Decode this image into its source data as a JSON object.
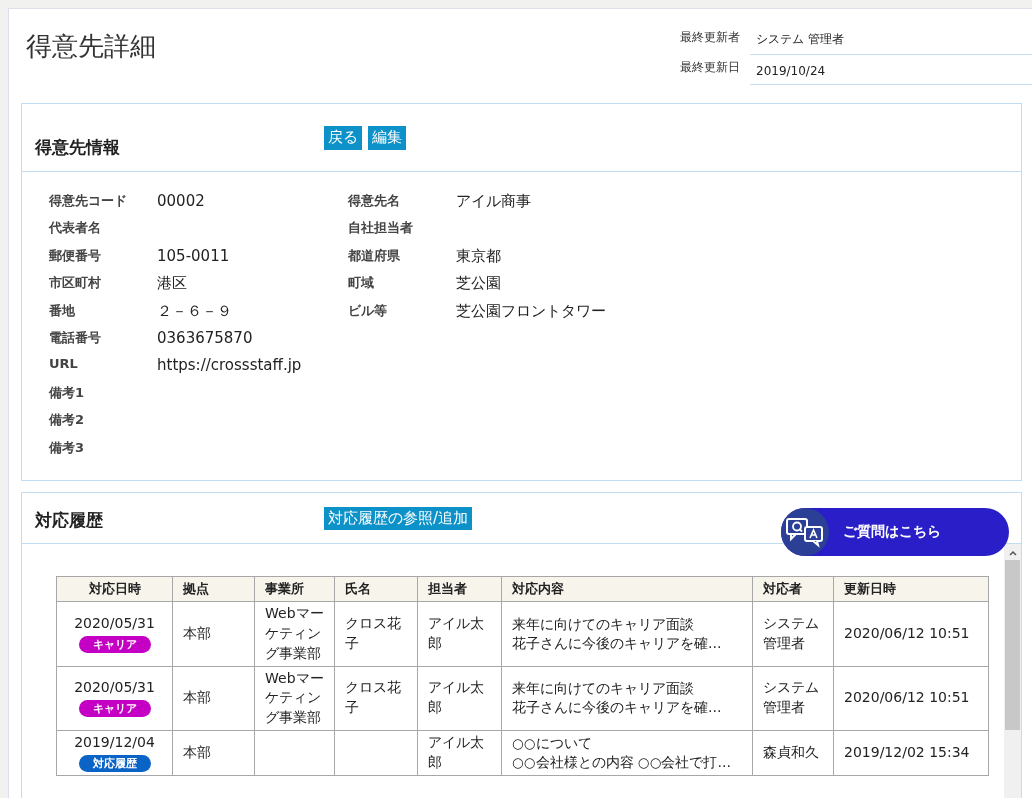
{
  "page_title": "得意先詳細",
  "meta": [
    {
      "label": "最終更新者",
      "value": "システム 管理者"
    },
    {
      "label": "最終更新日",
      "value": "2019/10/24"
    }
  ],
  "customer_info": {
    "title": "得意先情報",
    "buttons": [
      "戻る",
      "編集"
    ],
    "left_fields": [
      {
        "label": "得意先コード",
        "value": "00002"
      },
      {
        "label": "代表者名"
      },
      {
        "label": "郵便番号",
        "value": "105-0011"
      },
      {
        "label": "市区町村",
        "value": "港区"
      },
      {
        "label": "番地",
        "value": "２－６－９"
      },
      {
        "label": "電話番号",
        "value": "0363675870"
      },
      {
        "label": "URL",
        "value": "https://crossstaff.jp"
      },
      {
        "label": "備考1"
      },
      {
        "label": "備考2"
      },
      {
        "label": "備考3"
      }
    ],
    "right_fields": [
      {
        "label": "得意先名",
        "value": "アイル商事"
      },
      {
        "label": "自社担当者"
      },
      {
        "label": "都道府県",
        "value": "東京都"
      },
      {
        "label": "町域",
        "value": "芝公園"
      },
      {
        "label": "ビル等",
        "value": "芝公園フロントタワー"
      }
    ]
  },
  "history": {
    "title": "対応履歴",
    "button": "対応履歴の参照/追加",
    "table": {
      "columns": [
        "対応日時",
        "拠点",
        "事業所",
        "氏名",
        "担当者",
        "対応内容",
        "対応者",
        "更新日時"
      ],
      "rows": [
        {
          "date": "2020/05/31",
          "badge": {
            "label": "キャリア",
            "color": "#c400c4"
          },
          "base": "本部",
          "office": "Webマーケティング事業部",
          "name": "クロス花子",
          "staff": "アイル太郎",
          "content": [
            "来年に向けてのキャリア面談",
            "花子さんに今後のキャリアを確…"
          ],
          "responder": "システム管理者",
          "updated": "2020/06/12 10:51"
        },
        {
          "date": "2020/05/31",
          "badge": {
            "label": "キャリア",
            "color": "#c400c4"
          },
          "base": "本部",
          "office": "Webマーケティング事業部",
          "name": "クロス花子",
          "staff": "アイル太郎",
          "content": [
            "来年に向けてのキャリア面談",
            "花子さんに今後のキャリアを確…"
          ],
          "responder": "システム管理者",
          "updated": "2020/06/12 10:51"
        },
        {
          "date": "2019/12/04",
          "badge": {
            "label": "対応履歴",
            "color": "#0a64c8"
          },
          "base": "本部",
          "staff": "アイル太郎",
          "content": [
            "○○について",
            "○○会社様との内容 ○○会社で打…"
          ],
          "responder": "森貞和久",
          "updated": "2019/12/02 15:34"
        }
      ]
    }
  },
  "chat_button": {
    "label": "ご質問はこちら"
  }
}
